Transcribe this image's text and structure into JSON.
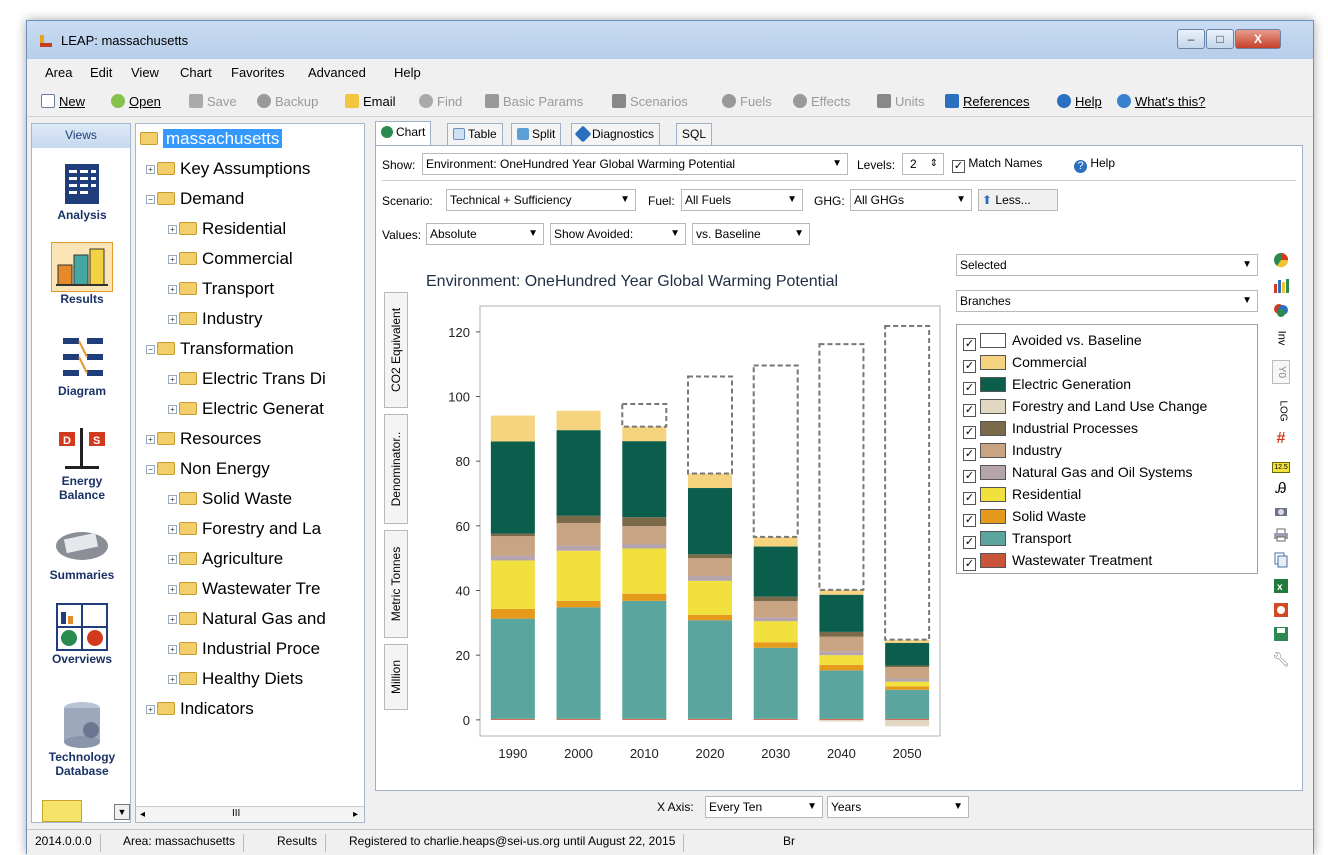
{
  "window": {
    "title": "LEAP: massachusetts",
    "min": "–",
    "max": "□",
    "close": "X"
  },
  "menu": [
    "Area",
    "Edit",
    "View",
    "Chart",
    "Favorites",
    "Advanced",
    "Help"
  ],
  "toolbar": {
    "new": "New",
    "open": "Open",
    "save": "Save",
    "backup": "Backup",
    "email": "Email",
    "find": "Find",
    "basic_params": "Basic Params",
    "scenarios": "Scenarios",
    "fuels": "Fuels",
    "effects": "Effects",
    "units": "Units",
    "references": "References",
    "help": "Help",
    "whats_this": "What's this?"
  },
  "views": {
    "header": "Views",
    "items": [
      "Analysis",
      "Results",
      "Diagram",
      "Energy Balance",
      "Summaries",
      "Overviews",
      "Technology Database"
    ]
  },
  "tree": {
    "root": "massachusetts",
    "nodes": [
      "Key Assumptions",
      "Demand",
      "Residential",
      "Commercial",
      "Transport",
      "Industry",
      "Transformation",
      "Electric Trans Di",
      "Electric Generat",
      "Resources",
      "Non Energy",
      "Solid Waste",
      "Forestry and La",
      "Agriculture",
      "Wastewater Tre",
      "Natural Gas and",
      "Industrial Proce",
      "Healthy Diets",
      "Indicators"
    ],
    "scroll_grip": "III"
  },
  "tabs": [
    "Chart",
    "Table",
    "Split",
    "Diagnostics",
    "SQL"
  ],
  "controls": {
    "show_label": "Show:",
    "show_value": "Environment: OneHundred Year Global Warming Potential",
    "levels_label": "Levels:",
    "levels_value": "2",
    "match_names": "Match Names",
    "help": "Help",
    "scenario_label": "Scenario:",
    "scenario_value": "Technical + Sufficiency",
    "fuel_label": "Fuel:",
    "fuel_value": "All Fuels",
    "ghg_label": "GHG:",
    "ghg_value": "All GHGs",
    "less": "Less...",
    "values_label": "Values:",
    "values_value": "Absolute",
    "show_avoided": "Show Avoided:",
    "vs_baseline": "vs. Baseline",
    "selected": "Selected",
    "branches": "Branches",
    "xaxis_label": "X Axis:",
    "xaxis_value": "Every Ten",
    "xaxis_unit": "Years"
  },
  "y_unit_buttons": [
    "CO2 Equivalent",
    "Denominator..",
    "Metric Tonnes",
    "Million"
  ],
  "side_tools": [
    "pie-chart-icon",
    "bar-chart-icon",
    "area-chart-icon",
    "Inv",
    "Y0",
    "LOG",
    "grid-icon",
    "12.5",
    "font-icon",
    "camera-icon",
    "print-icon",
    "copy-icon",
    "excel-icon",
    "powerpoint-icon",
    "save-icon",
    "wrench-icon"
  ],
  "side_labels": {
    "inv": "Inv",
    "y0": "Y0",
    "log": "LOG",
    "num": "12.5"
  },
  "status": {
    "version": "2014.0.0.0",
    "area": "Area: massachusetts",
    "view": "Results",
    "registered": "Registered to charlie.heaps@sei-us.org until August 22, 2015",
    "extra": "Br"
  },
  "chart_data": {
    "type": "bar",
    "stacked": true,
    "title": "Environment: OneHundred Year Global Warming Potential",
    "categories": [
      "1990",
      "2000",
      "2010",
      "2020",
      "2030",
      "2040",
      "2050"
    ],
    "ylim": [
      0,
      120
    ],
    "yticks": [
      0,
      20,
      40,
      60,
      80,
      100,
      120
    ],
    "negative_series": {
      "name": "Forestry and Land Use Change",
      "values": [
        0,
        0,
        0,
        0,
        0,
        -0.5,
        -2
      ]
    },
    "series": [
      {
        "name": "Wastewater Treatment",
        "color": "#c8553a",
        "values": [
          0.3,
          0.3,
          0.3,
          0.3,
          0.3,
          0.3,
          0.3
        ]
      },
      {
        "name": "Transport",
        "color": "#5aa59d",
        "values": [
          31,
          34.5,
          36.5,
          30.5,
          22,
          15,
          9
        ]
      },
      {
        "name": "Solid Waste",
        "color": "#e59a1c",
        "values": [
          3,
          2,
          2.2,
          1.7,
          1.7,
          1.7,
          1
        ]
      },
      {
        "name": "Residential",
        "color": "#f1e03e",
        "values": [
          15,
          15.5,
          14,
          10.5,
          6.5,
          3,
          1.5
        ]
      },
      {
        "name": "Natural Gas and Oil Systems",
        "color": "#b6a4ad",
        "values": [
          1.5,
          1.6,
          1.4,
          1.5,
          1.2,
          1.2,
          1
        ]
      },
      {
        "name": "Industry",
        "color": "#c8a482",
        "values": [
          6,
          7,
          5.5,
          5.5,
          5,
          4.5,
          3.5
        ]
      },
      {
        "name": "Industrial Processes",
        "color": "#7b6a4a",
        "values": [
          0.8,
          2.2,
          2.8,
          1.2,
          1.4,
          1.5,
          0.5
        ]
      },
      {
        "name": "Forestry and Land Use Change",
        "color": "#e2d7c2",
        "values": [
          0,
          0,
          0,
          0,
          0,
          0,
          0
        ]
      },
      {
        "name": "Electric Generation",
        "color": "#0b5e4b",
        "values": [
          28.5,
          26.5,
          23.5,
          20.5,
          15.5,
          11.5,
          7
        ]
      },
      {
        "name": "Commercial",
        "color": "#f6d37e",
        "values": [
          8,
          6,
          4.5,
          4.5,
          3,
          1.5,
          1
        ]
      },
      {
        "name": "Avoided vs. Baseline",
        "color": "#ffffff",
        "dashed": true,
        "values": [
          0,
          0,
          7,
          30,
          53,
          76,
          97
        ]
      }
    ],
    "legend": [
      "Avoided vs. Baseline",
      "Commercial",
      "Electric Generation",
      "Forestry and Land Use Change",
      "Industrial Processes",
      "Industry",
      "Natural Gas and Oil Systems",
      "Residential",
      "Solid Waste",
      "Transport",
      "Wastewater Treatment"
    ],
    "legend_colors": [
      "#ffffff",
      "#f6d37e",
      "#0b5e4b",
      "#e2d7c2",
      "#7b6a4a",
      "#c8a482",
      "#b6a4ad",
      "#f1e03e",
      "#e59a1c",
      "#5aa59d",
      "#c8553a"
    ],
    "legend_placement": "right",
    "grid": false
  }
}
